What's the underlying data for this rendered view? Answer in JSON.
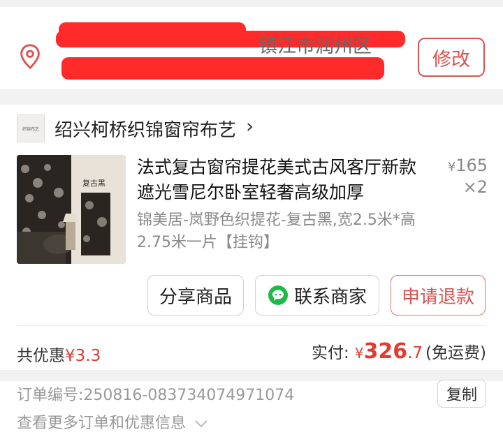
{
  "address": {
    "district_text": "镇江市润州区",
    "modify_label": "修改"
  },
  "shop": {
    "name": "绍兴柯桥织锦窗帘布艺",
    "logo_text": "织锦布艺",
    "chevron": "›"
  },
  "product": {
    "title": "法式复古窗帘提花美式古风客厅新款遮光雪尼尔卧室轻奢高级加厚",
    "currency": "¥",
    "price": "165",
    "quantity": "×2",
    "spec": "锦美居-岚野色织提花-复古黑,宽2.5米*高2.75米一片【挂钩】",
    "thumb_caption": "复古黑"
  },
  "actions": {
    "share": "分享商品",
    "contact": "联系商家",
    "refund": "申请退款"
  },
  "summary": {
    "discount_label": "共优惠",
    "discount_value": "¥3.3",
    "paid_label": "实付:",
    "currency": "¥",
    "paid_int": "326",
    "paid_dec": ".7",
    "shipping_note": "(免运费)"
  },
  "order": {
    "number_text": "订单编号:250816-083734074971074",
    "copy_label": "复制",
    "more_text": "查看更多订单和优惠信息"
  },
  "colors": {
    "accent_red": "#e23b33",
    "redaction": "#ff2a2a"
  }
}
